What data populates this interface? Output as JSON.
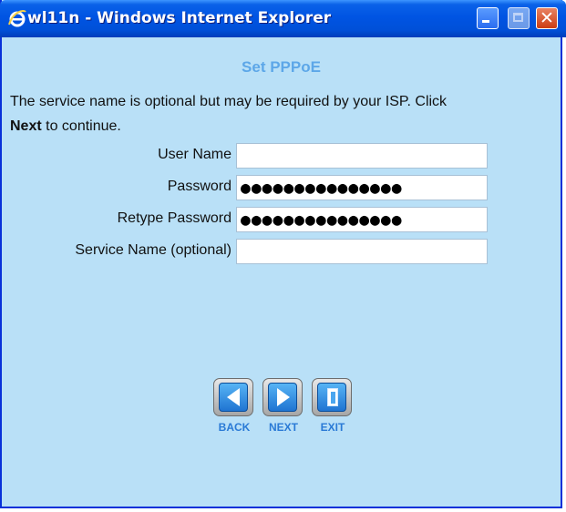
{
  "window": {
    "title": "wl11n - Windows Internet Explorer",
    "icons": [
      "ie-logo-icon",
      "minimize-icon",
      "maximize-icon",
      "close-icon"
    ]
  },
  "page": {
    "heading": "Set PPPoE",
    "description_before": "The service name is optional but may be required by your ISP. Click",
    "description_bold": "Next",
    "description_after": " to continue."
  },
  "form": {
    "user_name_label": "User Name",
    "user_name_value": "",
    "password_label": "Password",
    "password_value": "●●●●●●●●●●●●●●●",
    "retype_password_label": "Retype Password",
    "retype_password_value": "●●●●●●●●●●●●●●●",
    "service_name_label": "Service Name (optional)",
    "service_name_value": ""
  },
  "nav": {
    "back_label": "BACK",
    "next_label": "NEXT",
    "exit_label": "EXIT"
  },
  "colors": {
    "background": "#b9e0f7",
    "heading": "#5da7e8",
    "titlebar": "#0054e3",
    "button_label": "#2a7ad6"
  }
}
